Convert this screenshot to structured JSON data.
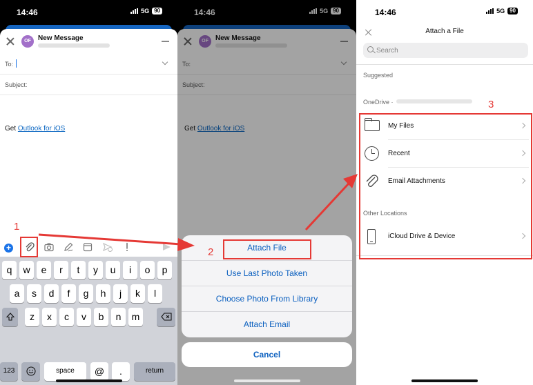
{
  "status": {
    "time": "14:46",
    "network": "5G",
    "battery": "90"
  },
  "compose": {
    "avatar_initials": "OF",
    "title": "New Message",
    "to_label": "To:",
    "subject_label": "Subject:",
    "signature_prefix": "Get ",
    "signature_link": "Outlook for iOS"
  },
  "icons": [
    "add-icon",
    "paperclip-icon",
    "camera-icon",
    "pen-icon",
    "calendar-icon",
    "send-later-icon",
    "priority-icon",
    "send-icon"
  ],
  "keyboard": {
    "row1": [
      "q",
      "w",
      "e",
      "r",
      "t",
      "y",
      "u",
      "i",
      "o",
      "p"
    ],
    "row2": [
      "a",
      "s",
      "d",
      "f",
      "g",
      "h",
      "j",
      "k",
      "l"
    ],
    "row3": [
      "z",
      "x",
      "c",
      "v",
      "b",
      "n",
      "m"
    ],
    "numbers": "123",
    "space": "space",
    "at": "@",
    "dot": ".",
    "return": "return"
  },
  "action_sheet": {
    "items": [
      "Attach File",
      "Use Last Photo Taken",
      "Choose Photo From Library",
      "Attach Email"
    ],
    "cancel": "Cancel"
  },
  "attach_file": {
    "title": "Attach a File",
    "search_placeholder": "Search",
    "suggested": "Suggested",
    "onedrive_label": "OneDrive ·",
    "locations": [
      "My Files",
      "Recent",
      "Email Attachments"
    ],
    "other_locations": "Other Locations",
    "icloud": "iCloud Drive & Device"
  },
  "annotations": {
    "step1": "1",
    "step2": "2",
    "step3": "3"
  },
  "colors": {
    "accent": "#0a5fbf",
    "annotation_red": "#e53935",
    "avatar": "#a270c9"
  }
}
